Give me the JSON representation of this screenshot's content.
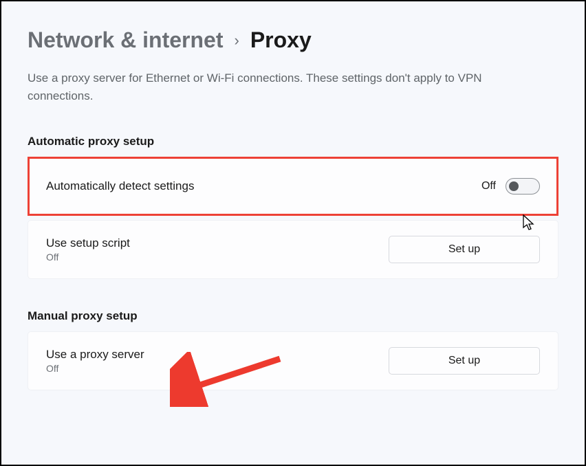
{
  "breadcrumb": {
    "parent": "Network & internet",
    "current": "Proxy"
  },
  "description": "Use a proxy server for Ethernet or Wi-Fi connections. These settings don't apply to VPN connections.",
  "sections": {
    "automatic": {
      "heading": "Automatic proxy setup",
      "detect": {
        "title": "Automatically detect settings",
        "toggle_label": "Off"
      },
      "script": {
        "title": "Use setup script",
        "status": "Off",
        "button": "Set up"
      }
    },
    "manual": {
      "heading": "Manual proxy setup",
      "server": {
        "title": "Use a proxy server",
        "status": "Off",
        "button": "Set up"
      }
    }
  }
}
